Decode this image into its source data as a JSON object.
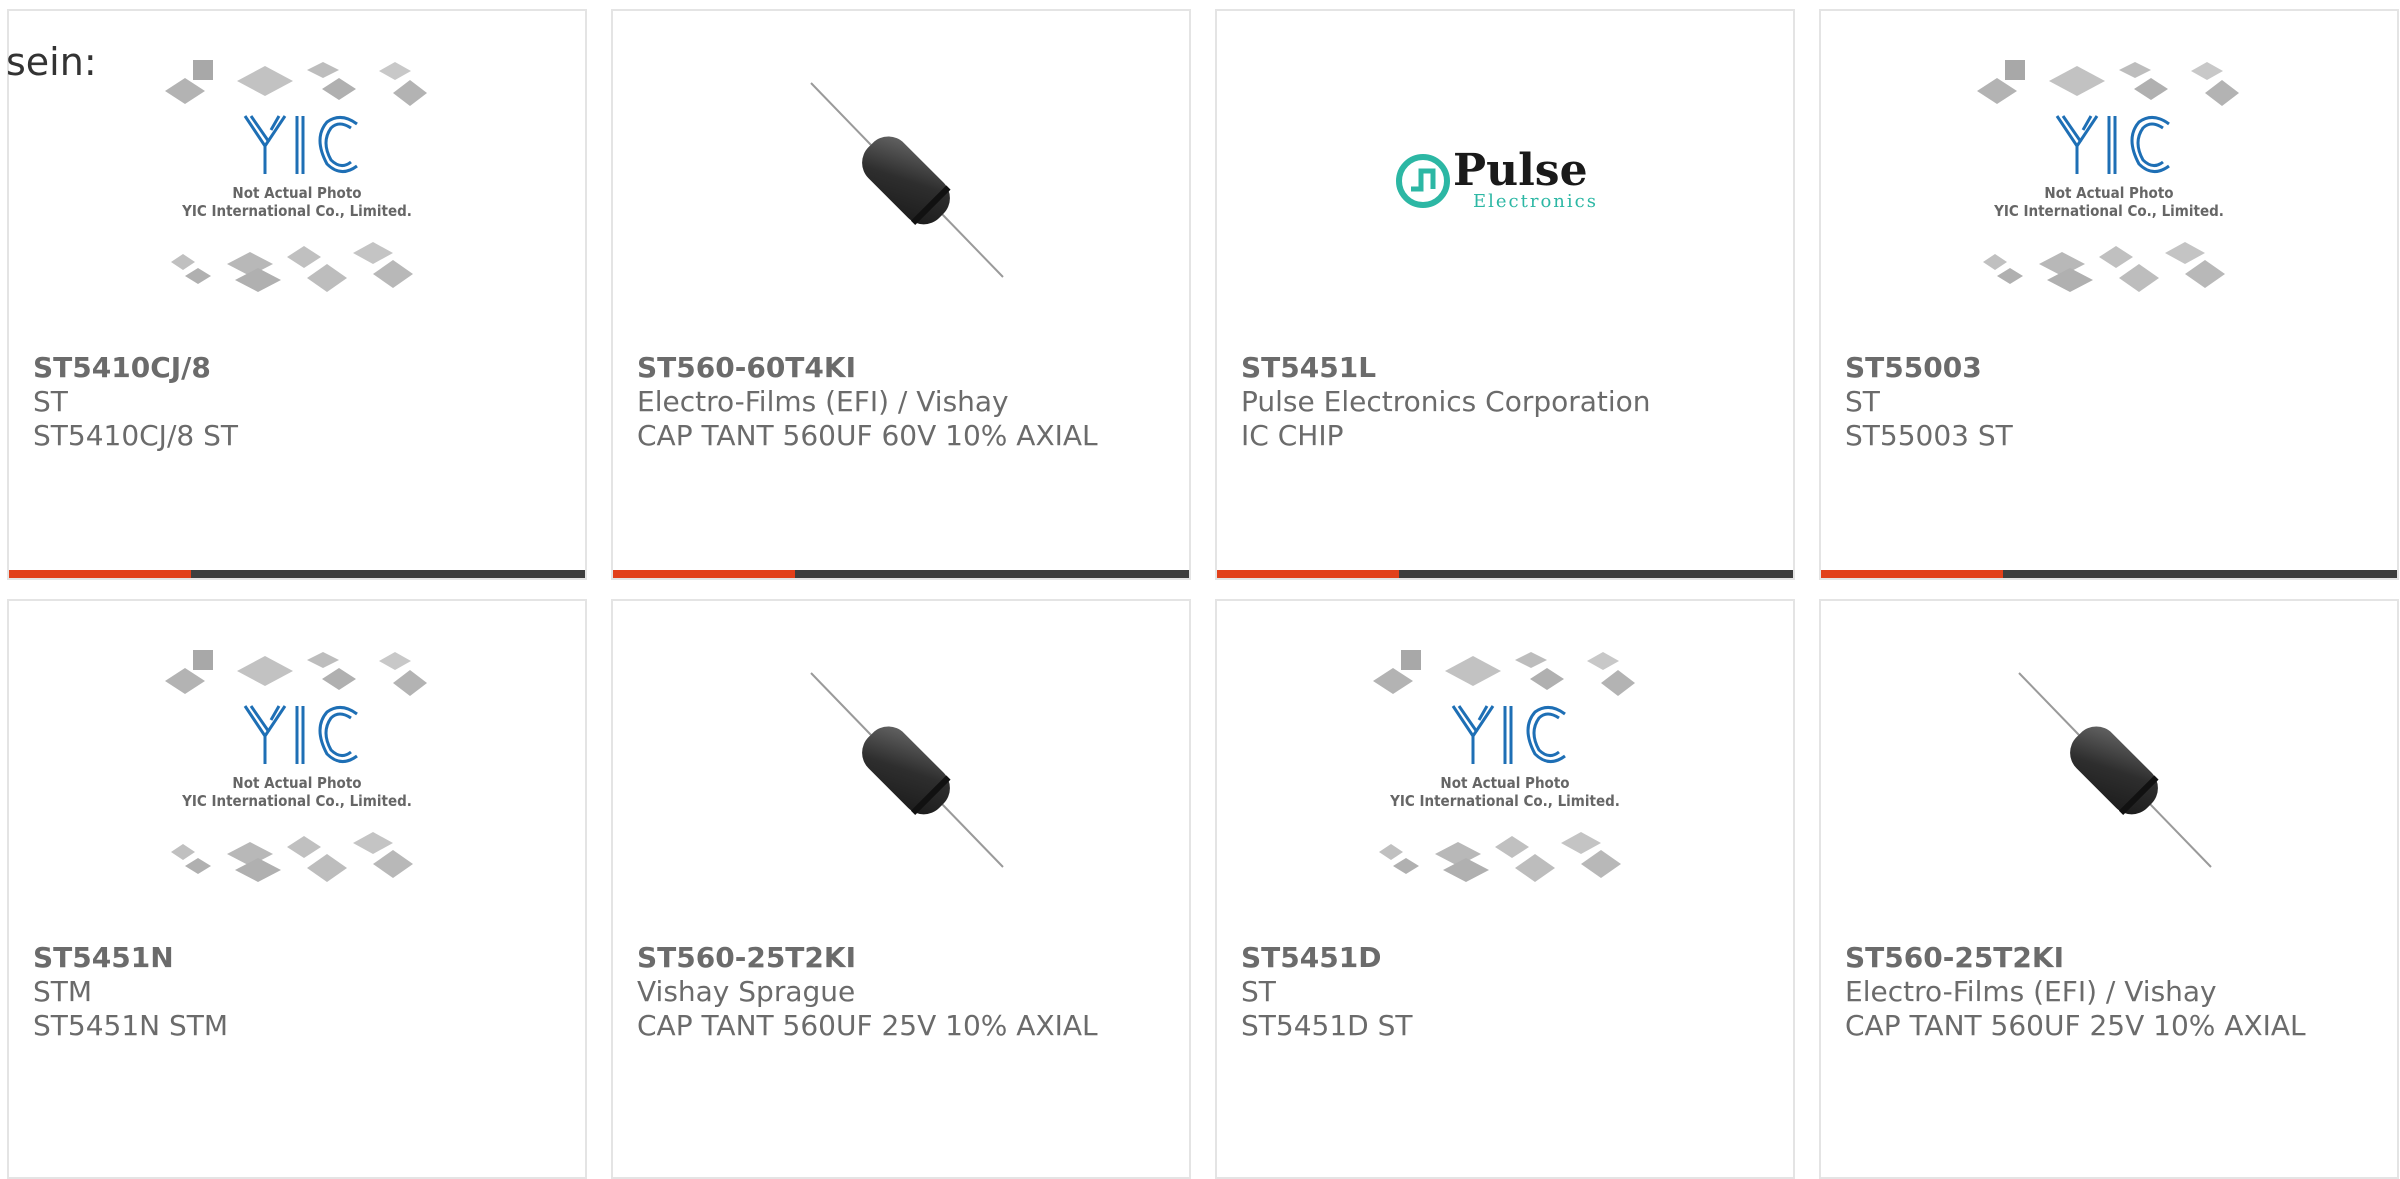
{
  "intro_text": "sein:",
  "placeholder": {
    "logo_text": "YIC",
    "line1": "Not Actual Photo",
    "line2": "YIC International Co., Limited."
  },
  "pulse_logo": {
    "name": "Pulse",
    "sub": "Electronics"
  },
  "colors": {
    "accent": "#e2401a",
    "bar": "#3e3e3e",
    "yic_blue": "#1e6fb5",
    "pulse_teal": "#2cb7a4"
  },
  "products": [
    {
      "part": "ST5410CJ/8",
      "manufacturer": "ST",
      "description": "ST5410CJ/8 ST",
      "image": "yic-placeholder"
    },
    {
      "part": "ST560-60T4KI",
      "manufacturer": "Electro-Films (EFI) / Vishay",
      "description": "CAP TANT 560UF 60V 10% AXIAL",
      "image": "axial-capacitor"
    },
    {
      "part": "ST5451L",
      "manufacturer": "Pulse Electronics Corporation",
      "description": "IC CHIP",
      "image": "pulse-logo"
    },
    {
      "part": "ST55003",
      "manufacturer": "ST",
      "description": "ST55003 ST",
      "image": "yic-placeholder"
    },
    {
      "part": "ST5451N",
      "manufacturer": "STM",
      "description": "ST5451N STM",
      "image": "yic-placeholder"
    },
    {
      "part": "ST560-25T2KI",
      "manufacturer": "Vishay Sprague",
      "description": "CAP TANT 560UF 25V 10% AXIAL",
      "image": "axial-capacitor"
    },
    {
      "part": "ST5451D",
      "manufacturer": "ST",
      "description": "ST5451D ST",
      "image": "yic-placeholder"
    },
    {
      "part": "ST560-25T2KI",
      "manufacturer": "Electro-Films (EFI) / Vishay",
      "description": "CAP TANT 560UF 25V 10% AXIAL",
      "image": "axial-capacitor"
    }
  ]
}
